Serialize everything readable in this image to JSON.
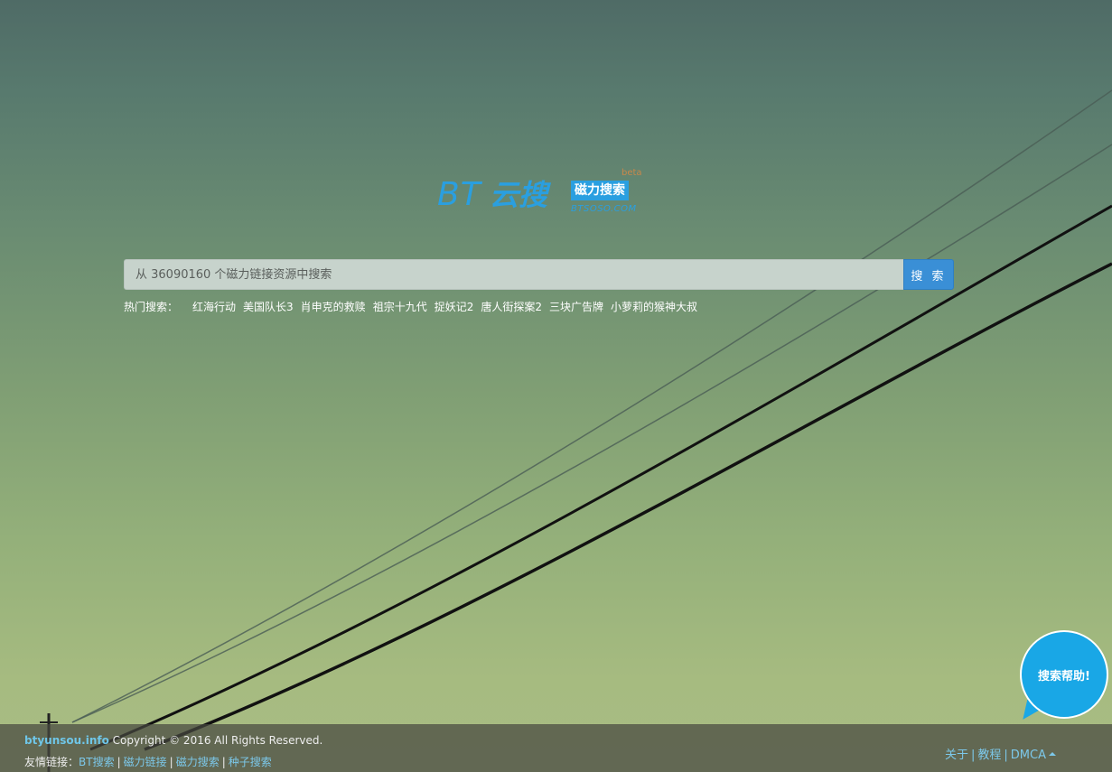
{
  "logo": {
    "bt": "BT",
    "yun": "云搜",
    "tag": "磁力搜索",
    "beta": "beta",
    "domain": "BTSOSO.COM"
  },
  "search": {
    "placeholder": "从 36090160 个磁力链接资源中搜索",
    "button_label": "搜 索"
  },
  "hot": {
    "label": "热门搜索：",
    "items": [
      "红海行动",
      "美国队长3",
      "肖申克的救赎",
      "祖宗十九代",
      "捉妖记2",
      "唐人街探案2",
      "三块广告牌",
      "小萝莉的猴神大叔"
    ]
  },
  "help": {
    "label": "搜索帮助!"
  },
  "footer": {
    "brand": "btyunsou.info",
    "copyright": "Copyright © 2016 All Rights Reserved.",
    "friends_label": "友情链接：",
    "friend_links": [
      "BT搜索",
      "磁力链接",
      "磁力搜索",
      "种子搜索"
    ],
    "right_links": [
      "关于",
      "教程",
      "DMCA"
    ],
    "divider": "|"
  },
  "colors": {
    "accent": "#2a9fe0",
    "button": "#3a8fd6",
    "bubble": "#19a7e6"
  }
}
